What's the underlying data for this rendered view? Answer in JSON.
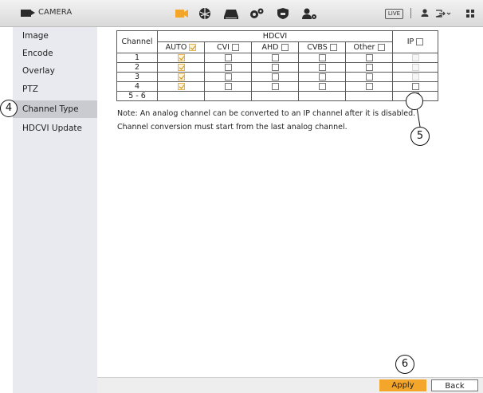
{
  "header": {
    "title": "CAMERA",
    "live_label": "LIVE",
    "accent_color": "#f4a62a",
    "module_icons": [
      "camera-icon",
      "network-icon",
      "storage-icon",
      "system-icon",
      "security-icon",
      "account-icon"
    ],
    "right_icons": [
      "user-icon",
      "logout-icon",
      "grid-icon"
    ]
  },
  "sidebar": {
    "items": [
      {
        "label": "Image"
      },
      {
        "label": "Encode"
      },
      {
        "label": "Overlay"
      },
      {
        "label": "PTZ"
      },
      {
        "label": "Channel Type",
        "active": true
      },
      {
        "label": "HDCVI Update"
      }
    ]
  },
  "table": {
    "col_channel": "Channel",
    "col_hdcvi": "HDCVI",
    "col_auto": "AUTO",
    "col_cvi": "CVI",
    "col_ahd": "AHD",
    "col_cvbs": "CVBS",
    "col_other": "Other",
    "col_ip": "IP",
    "rows": [
      {
        "channel": "1",
        "auto": true
      },
      {
        "channel": "2",
        "auto": true
      },
      {
        "channel": "3",
        "auto": true
      },
      {
        "channel": "4",
        "auto": true
      },
      {
        "channel": "5 - 6"
      }
    ]
  },
  "notes": {
    "line1": "Note: An analog channel can be converted to an IP channel after it is disabled.",
    "line2": "Channel conversion must start from the last analog channel."
  },
  "callouts": {
    "c4": "4",
    "c5": "5",
    "c6": "6"
  },
  "footer": {
    "apply_label": "Apply",
    "back_label": "Back"
  }
}
